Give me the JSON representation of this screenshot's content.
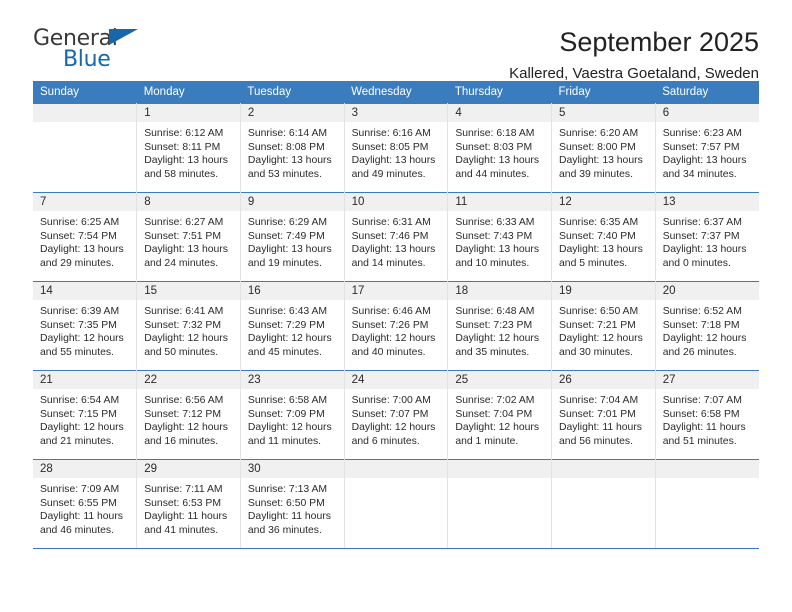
{
  "logo": {
    "word_top": "General",
    "word_bottom": "Blue",
    "triangle_icon": "triangle-icon",
    "accent_color": "#1767ab"
  },
  "header": {
    "title": "September 2025",
    "subtitle": "Kallered, Vaestra Goetaland, Sweden"
  },
  "theme": {
    "header_bg": "#3a7cbe",
    "daynum_bg": "#f0f0f0",
    "grid_line": "#e2e2e2",
    "text": "#2b2b2b"
  },
  "weekday_headers": [
    "Sunday",
    "Monday",
    "Tuesday",
    "Wednesday",
    "Thursday",
    "Friday",
    "Saturday"
  ],
  "weeks": [
    [
      {
        "day": "",
        "blank": true,
        "sunrise": "",
        "sunset": "",
        "daylight": ""
      },
      {
        "day": "1",
        "sunrise": "Sunrise: 6:12 AM",
        "sunset": "Sunset: 8:11 PM",
        "daylight": "Daylight: 13 hours and 58 minutes."
      },
      {
        "day": "2",
        "sunrise": "Sunrise: 6:14 AM",
        "sunset": "Sunset: 8:08 PM",
        "daylight": "Daylight: 13 hours and 53 minutes."
      },
      {
        "day": "3",
        "sunrise": "Sunrise: 6:16 AM",
        "sunset": "Sunset: 8:05 PM",
        "daylight": "Daylight: 13 hours and 49 minutes."
      },
      {
        "day": "4",
        "sunrise": "Sunrise: 6:18 AM",
        "sunset": "Sunset: 8:03 PM",
        "daylight": "Daylight: 13 hours and 44 minutes."
      },
      {
        "day": "5",
        "sunrise": "Sunrise: 6:20 AM",
        "sunset": "Sunset: 8:00 PM",
        "daylight": "Daylight: 13 hours and 39 minutes."
      },
      {
        "day": "6",
        "sunrise": "Sunrise: 6:23 AM",
        "sunset": "Sunset: 7:57 PM",
        "daylight": "Daylight: 13 hours and 34 minutes."
      }
    ],
    [
      {
        "day": "7",
        "sunrise": "Sunrise: 6:25 AM",
        "sunset": "Sunset: 7:54 PM",
        "daylight": "Daylight: 13 hours and 29 minutes."
      },
      {
        "day": "8",
        "sunrise": "Sunrise: 6:27 AM",
        "sunset": "Sunset: 7:51 PM",
        "daylight": "Daylight: 13 hours and 24 minutes."
      },
      {
        "day": "9",
        "sunrise": "Sunrise: 6:29 AM",
        "sunset": "Sunset: 7:49 PM",
        "daylight": "Daylight: 13 hours and 19 minutes."
      },
      {
        "day": "10",
        "sunrise": "Sunrise: 6:31 AM",
        "sunset": "Sunset: 7:46 PM",
        "daylight": "Daylight: 13 hours and 14 minutes."
      },
      {
        "day": "11",
        "sunrise": "Sunrise: 6:33 AM",
        "sunset": "Sunset: 7:43 PM",
        "daylight": "Daylight: 13 hours and 10 minutes."
      },
      {
        "day": "12",
        "sunrise": "Sunrise: 6:35 AM",
        "sunset": "Sunset: 7:40 PM",
        "daylight": "Daylight: 13 hours and 5 minutes."
      },
      {
        "day": "13",
        "sunrise": "Sunrise: 6:37 AM",
        "sunset": "Sunset: 7:37 PM",
        "daylight": "Daylight: 13 hours and 0 minutes."
      }
    ],
    [
      {
        "day": "14",
        "sunrise": "Sunrise: 6:39 AM",
        "sunset": "Sunset: 7:35 PM",
        "daylight": "Daylight: 12 hours and 55 minutes."
      },
      {
        "day": "15",
        "sunrise": "Sunrise: 6:41 AM",
        "sunset": "Sunset: 7:32 PM",
        "daylight": "Daylight: 12 hours and 50 minutes."
      },
      {
        "day": "16",
        "sunrise": "Sunrise: 6:43 AM",
        "sunset": "Sunset: 7:29 PM",
        "daylight": "Daylight: 12 hours and 45 minutes."
      },
      {
        "day": "17",
        "sunrise": "Sunrise: 6:46 AM",
        "sunset": "Sunset: 7:26 PM",
        "daylight": "Daylight: 12 hours and 40 minutes."
      },
      {
        "day": "18",
        "sunrise": "Sunrise: 6:48 AM",
        "sunset": "Sunset: 7:23 PM",
        "daylight": "Daylight: 12 hours and 35 minutes."
      },
      {
        "day": "19",
        "sunrise": "Sunrise: 6:50 AM",
        "sunset": "Sunset: 7:21 PM",
        "daylight": "Daylight: 12 hours and 30 minutes."
      },
      {
        "day": "20",
        "sunrise": "Sunrise: 6:52 AM",
        "sunset": "Sunset: 7:18 PM",
        "daylight": "Daylight: 12 hours and 26 minutes."
      }
    ],
    [
      {
        "day": "21",
        "sunrise": "Sunrise: 6:54 AM",
        "sunset": "Sunset: 7:15 PM",
        "daylight": "Daylight: 12 hours and 21 minutes."
      },
      {
        "day": "22",
        "sunrise": "Sunrise: 6:56 AM",
        "sunset": "Sunset: 7:12 PM",
        "daylight": "Daylight: 12 hours and 16 minutes."
      },
      {
        "day": "23",
        "sunrise": "Sunrise: 6:58 AM",
        "sunset": "Sunset: 7:09 PM",
        "daylight": "Daylight: 12 hours and 11 minutes."
      },
      {
        "day": "24",
        "sunrise": "Sunrise: 7:00 AM",
        "sunset": "Sunset: 7:07 PM",
        "daylight": "Daylight: 12 hours and 6 minutes."
      },
      {
        "day": "25",
        "sunrise": "Sunrise: 7:02 AM",
        "sunset": "Sunset: 7:04 PM",
        "daylight": "Daylight: 12 hours and 1 minute."
      },
      {
        "day": "26",
        "sunrise": "Sunrise: 7:04 AM",
        "sunset": "Sunset: 7:01 PM",
        "daylight": "Daylight: 11 hours and 56 minutes."
      },
      {
        "day": "27",
        "sunrise": "Sunrise: 7:07 AM",
        "sunset": "Sunset: 6:58 PM",
        "daylight": "Daylight: 11 hours and 51 minutes."
      }
    ],
    [
      {
        "day": "28",
        "sunrise": "Sunrise: 7:09 AM",
        "sunset": "Sunset: 6:55 PM",
        "daylight": "Daylight: 11 hours and 46 minutes."
      },
      {
        "day": "29",
        "sunrise": "Sunrise: 7:11 AM",
        "sunset": "Sunset: 6:53 PM",
        "daylight": "Daylight: 11 hours and 41 minutes."
      },
      {
        "day": "30",
        "sunrise": "Sunrise: 7:13 AM",
        "sunset": "Sunset: 6:50 PM",
        "daylight": "Daylight: 11 hours and 36 minutes."
      },
      {
        "day": "",
        "blank": true,
        "sunrise": "",
        "sunset": "",
        "daylight": ""
      },
      {
        "day": "",
        "blank": true,
        "sunrise": "",
        "sunset": "",
        "daylight": ""
      },
      {
        "day": "",
        "blank": true,
        "sunrise": "",
        "sunset": "",
        "daylight": ""
      },
      {
        "day": "",
        "blank": true,
        "sunrise": "",
        "sunset": "",
        "daylight": ""
      }
    ]
  ]
}
